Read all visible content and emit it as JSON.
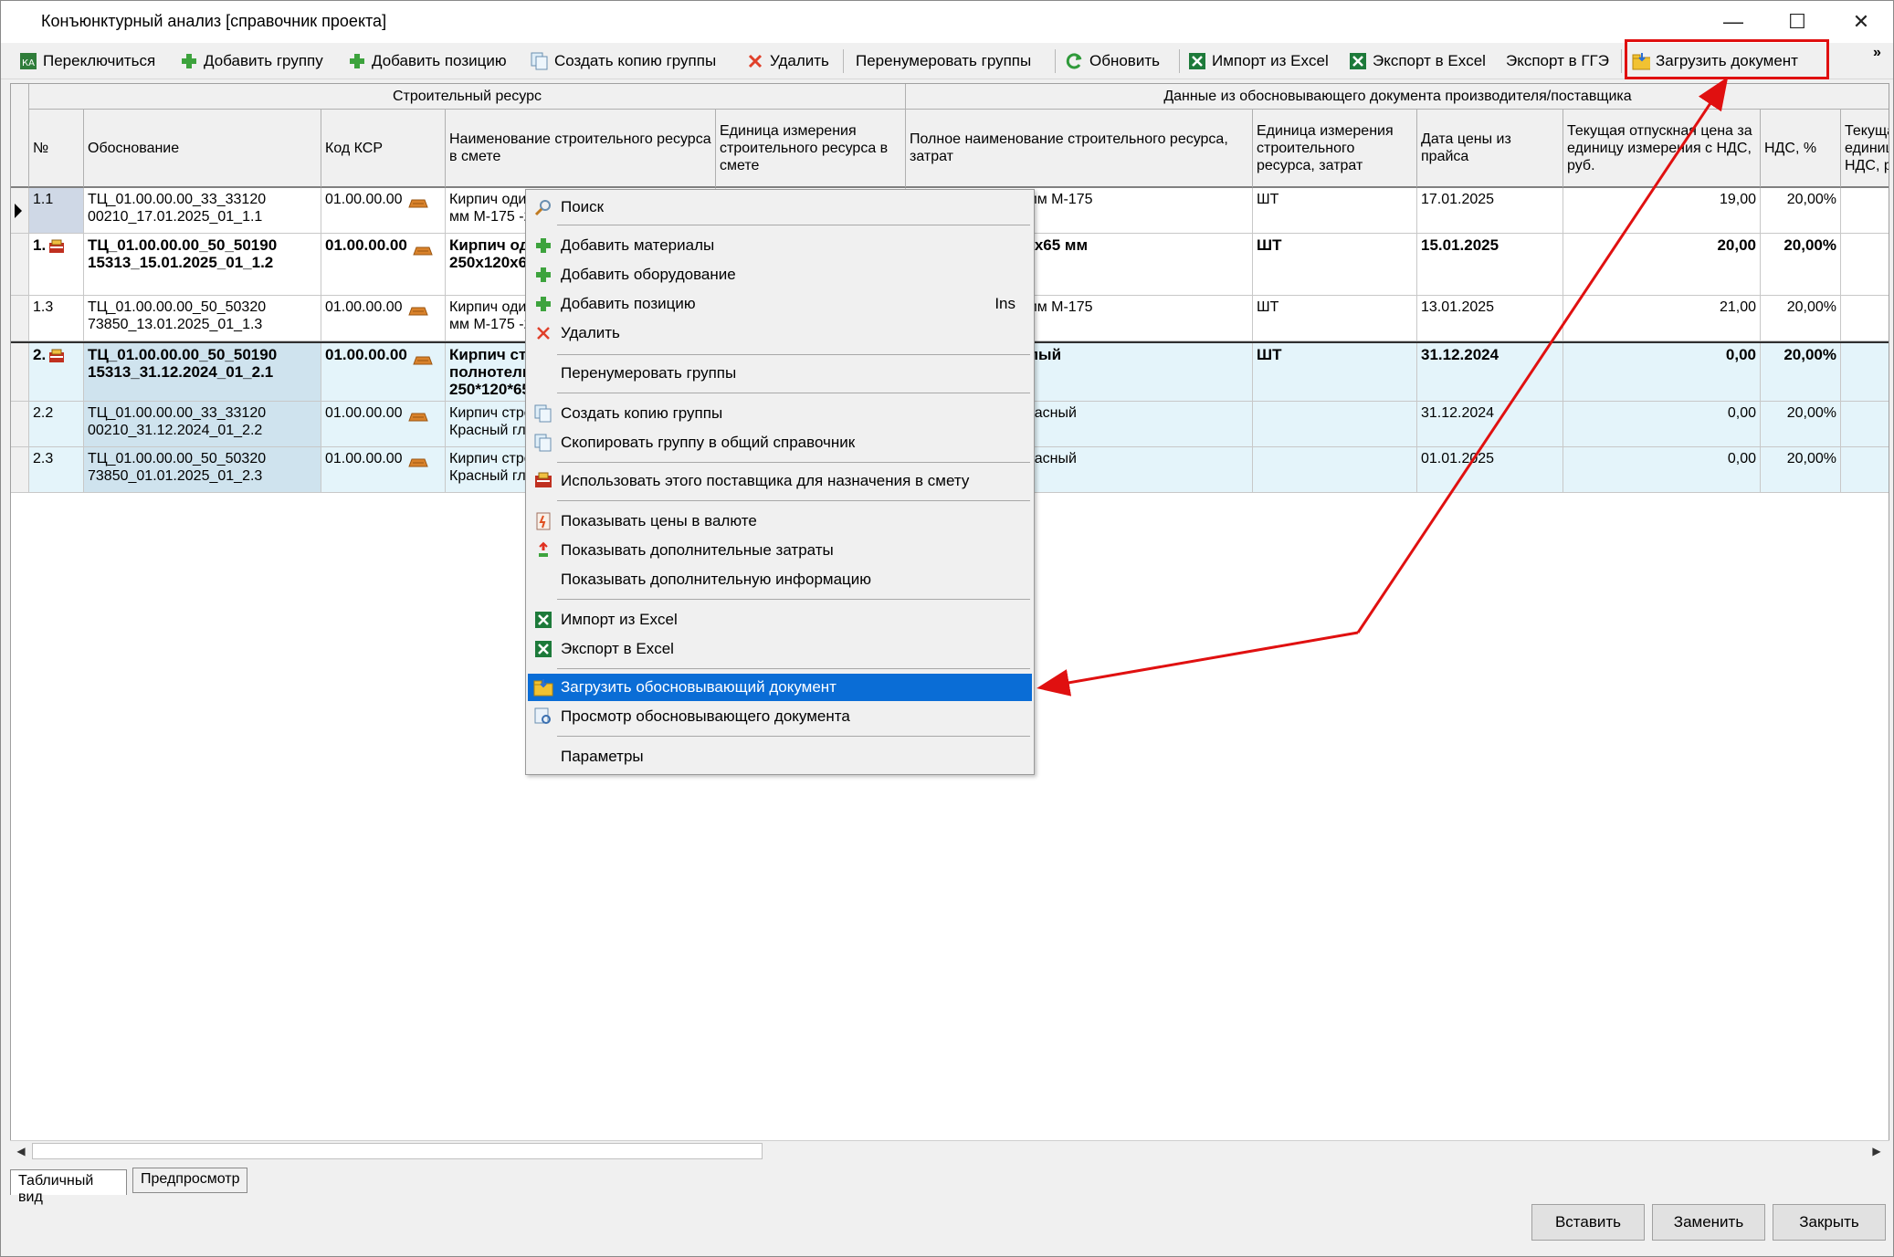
{
  "window": {
    "title": "Конъюнктурный анализ [справочник проекта]",
    "min_glyph": "—",
    "max_glyph": "☐",
    "close_glyph": "✕"
  },
  "toolbar": {
    "switch": "Переключиться",
    "add_group": "Добавить группу",
    "add_position": "Добавить позицию",
    "copy_group": "Создать копию группы",
    "delete": "Удалить",
    "renumber": "Перенумеровать группы",
    "refresh": "Обновить",
    "import_excel": "Импорт из Excel",
    "export_excel": "Экспорт в Excel",
    "export_gge": "Экспорт в ГГЭ",
    "load_doc": "Загрузить документ",
    "more": "»"
  },
  "grid": {
    "group_headers": {
      "resource": "Строительный ресурс",
      "supplier_doc": "Данные из обосновывающего документа производителя/поставщика"
    },
    "columns": {
      "num": "№",
      "basis": "Обоснование",
      "ksr": "Код КСР",
      "name": "Наименование строительного ресурса в смете",
      "unit": "Единица измерения строительного ресурса в смете",
      "full_name": "Полное наименование строительного ресурса, затрат",
      "unit2": "Единица измерения строительного ресурса, затрат",
      "price_date": "Дата цены из прайса",
      "price": "Текущая отпускная цена за единицу измерения с НДС, руб.",
      "vat": "НДС, %",
      "price2": "Текуща единиц НДС, р"
    },
    "rows": [
      {
        "num": "1.1",
        "basis": "ТЦ_01.00.00.00_33_33120\n00210_17.01.2025_01_1.1",
        "ksr": "01.00.00.00",
        "name": "Кирпич один\nмм М-175 -2",
        "full_name": "1НФ 250х120х65 мм М-175",
        "unit2": "ШТ",
        "date": "17.01.2025",
        "price": "19,00",
        "vat": "20,00%"
      },
      {
        "num": "1.",
        "basis": "ТЦ_01.00.00.00_50_50190\n15313_15.01.2025_01_1.2",
        "ksr": "01.00.00.00",
        "name": "Кирпич оди\n250х120х6",
        "full_name": "ый 1НФ 250х120х65 мм",
        "unit2": "ШТ",
        "date": "15.01.2025",
        "price": "20,00",
        "vat": "20,00%"
      },
      {
        "num": "1.3",
        "basis": "ТЦ_01.00.00.00_50_50320\n73850_13.01.2025_01_1.3",
        "ksr": "01.00.00.00",
        "name": "Кирпич один\nмм М-175 -2",
        "full_name": "1НФ 250х120х65 мм М-175",
        "unit2": "ШТ",
        "date": "13.01.2025",
        "price": "21,00",
        "vat": "20,00%"
      },
      {
        "num": "2.",
        "basis": "ТЦ_01.00.00.00_50_50190\n15313_31.12.2024_01_2.1",
        "ksr": "01.00.00.00",
        "name": "Кирпич стр\nполнотель\n250*120*65",
        "full_name": "льный полнотелый\nй 250*120*65мм",
        "unit2": "ШТ",
        "date": "31.12.2024",
        "price": "0,00",
        "vat": "20,00%"
      },
      {
        "num": "2.2",
        "basis": "ТЦ_01.00.00.00_33_33120\n00210_31.12.2024_01_2.2",
        "ksr": "01.00.00.00",
        "name": "Кирпич стро\nКрасный гла",
        "full_name": "ый полнотелый Красный\nмм",
        "unit2": "",
        "date": "31.12.2024",
        "price": "0,00",
        "vat": "20,00%"
      },
      {
        "num": "2.3",
        "basis": "ТЦ_01.00.00.00_50_50320\n73850_01.01.2025_01_2.3",
        "ksr": "01.00.00.00",
        "name": "Кирпич стро\nКрасный гла",
        "full_name": "ый полнотелый Красный\nмм",
        "unit2": "",
        "date": "01.01.2025",
        "price": "0,00",
        "vat": "20,00%"
      }
    ]
  },
  "context_menu": {
    "search": "Поиск",
    "add_materials": "Добавить материалы",
    "add_equipment": "Добавить оборудование",
    "add_position": "Добавить позицию",
    "add_position_shortcut": "Ins",
    "delete": "Удалить",
    "renumber": "Перенумеровать группы",
    "copy_group": "Создать копию группы",
    "copy_to_common": "Скопировать группу в общий справочник",
    "use_supplier": "Использовать этого поставщика для назначения в смету",
    "show_currency": "Показывать цены в валюте",
    "show_extra_costs": "Показывать дополнительные затраты",
    "show_extra_info": "Показывать дополнительную информацию",
    "import_excel": "Импорт из Excel",
    "export_excel": "Экспорт в Excel",
    "load_basis_doc": "Загрузить обосновывающий документ",
    "view_basis_doc": "Просмотр обосновывающего документа",
    "params": "Параметры"
  },
  "tabs": {
    "table_view": "Табличный вид",
    "preview": "Предпросмотр"
  },
  "buttons": {
    "insert": "Вставить",
    "replace": "Заменить",
    "close": "Закрыть"
  },
  "colors": {
    "accent_red": "#e01010",
    "selection_blue": "#0a6dd6",
    "row_shade": "#e4f4fa"
  }
}
